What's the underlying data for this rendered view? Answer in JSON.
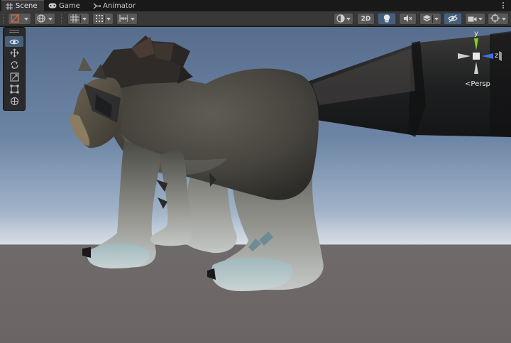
{
  "tabs": [
    {
      "label": "Scene",
      "icon": "scene-grid-icon",
      "active": true
    },
    {
      "label": "Game",
      "icon": "gamepad-icon",
      "active": false
    },
    {
      "label": "Animator",
      "icon": "animator-icon",
      "active": false
    }
  ],
  "toolbar": {
    "toggle_2d_label": "2D"
  },
  "tools": [
    "view-tool",
    "move-tool",
    "rotate-tool",
    "scale-tool",
    "rect-tool",
    "transform-tool"
  ],
  "active_tool": "view-tool",
  "gizmo": {
    "y_label": "y",
    "z_label": "z",
    "projection_label": "Persp"
  },
  "colors": {
    "tab_bg": "#191919",
    "toolbar_bg": "#383838",
    "button_active": "#46607c",
    "gizmo_y": "#7ed321",
    "gizmo_z": "#3f6fe0",
    "gizmo_x": "#d0d0d0"
  }
}
